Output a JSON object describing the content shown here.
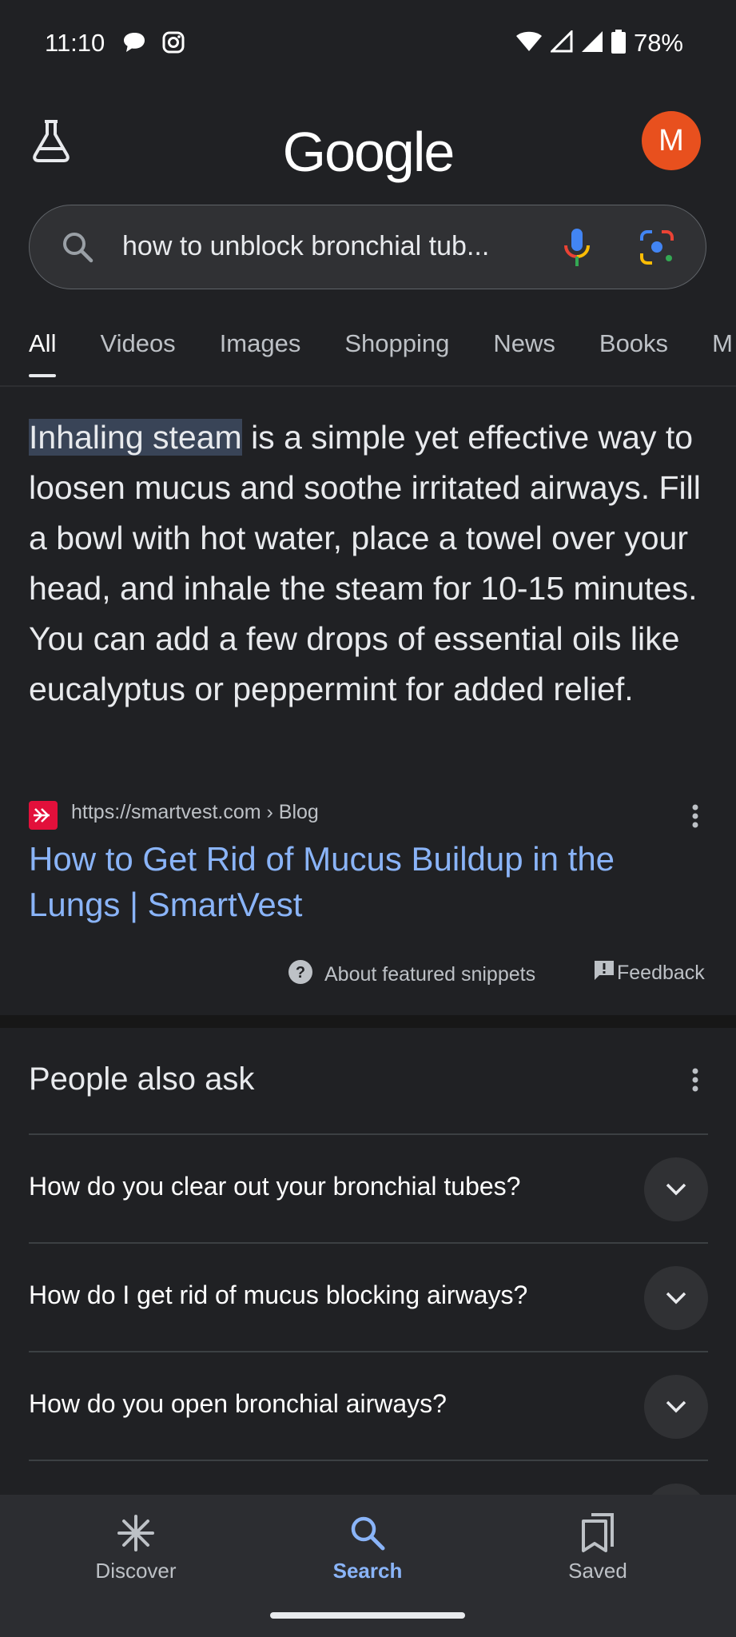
{
  "status_bar": {
    "time": "11:10",
    "battery": "78%",
    "icons": [
      "chat-bubble-icon",
      "instagram-icon",
      "wifi-icon",
      "signal-icon",
      "signal-icon",
      "battery-icon"
    ]
  },
  "header": {
    "logo": "Google",
    "avatar_letter": "M",
    "labs_icon": "flask-icon"
  },
  "search": {
    "query": "how to unblock bronchial tub..."
  },
  "tabs": [
    "All",
    "Videos",
    "Images",
    "Shopping",
    "News",
    "Books",
    "M"
  ],
  "snippet": {
    "highlight": "Inhaling steam",
    "text": " is a simple yet effective way to loosen mucus and soothe irritated airways. Fill a bowl with hot water, place a towel over your head, and inhale the steam for 10-15 minutes. You can add a few drops of essential oils like eucalyptus or peppermint for added relief.",
    "source_url": "https://smartvest.com › Blog",
    "title": "How to Get Rid of Mucus Buildup in the Lungs | SmartVest",
    "about_label": "About featured snippets",
    "feedback_label": "Feedback"
  },
  "people_also_ask": {
    "title": "People also ask",
    "questions": [
      "How do you clear out your bronchial tubes?",
      "How do I get rid of mucus blocking airways?",
      "How do you open bronchial airways?"
    ]
  },
  "bottom_nav": {
    "items": [
      "Discover",
      "Search",
      "Saved"
    ],
    "active": "Search"
  },
  "colors": {
    "background": "#202124",
    "link": "#8ab4f8",
    "avatar": "#e8501e",
    "highlight": "#394457"
  }
}
